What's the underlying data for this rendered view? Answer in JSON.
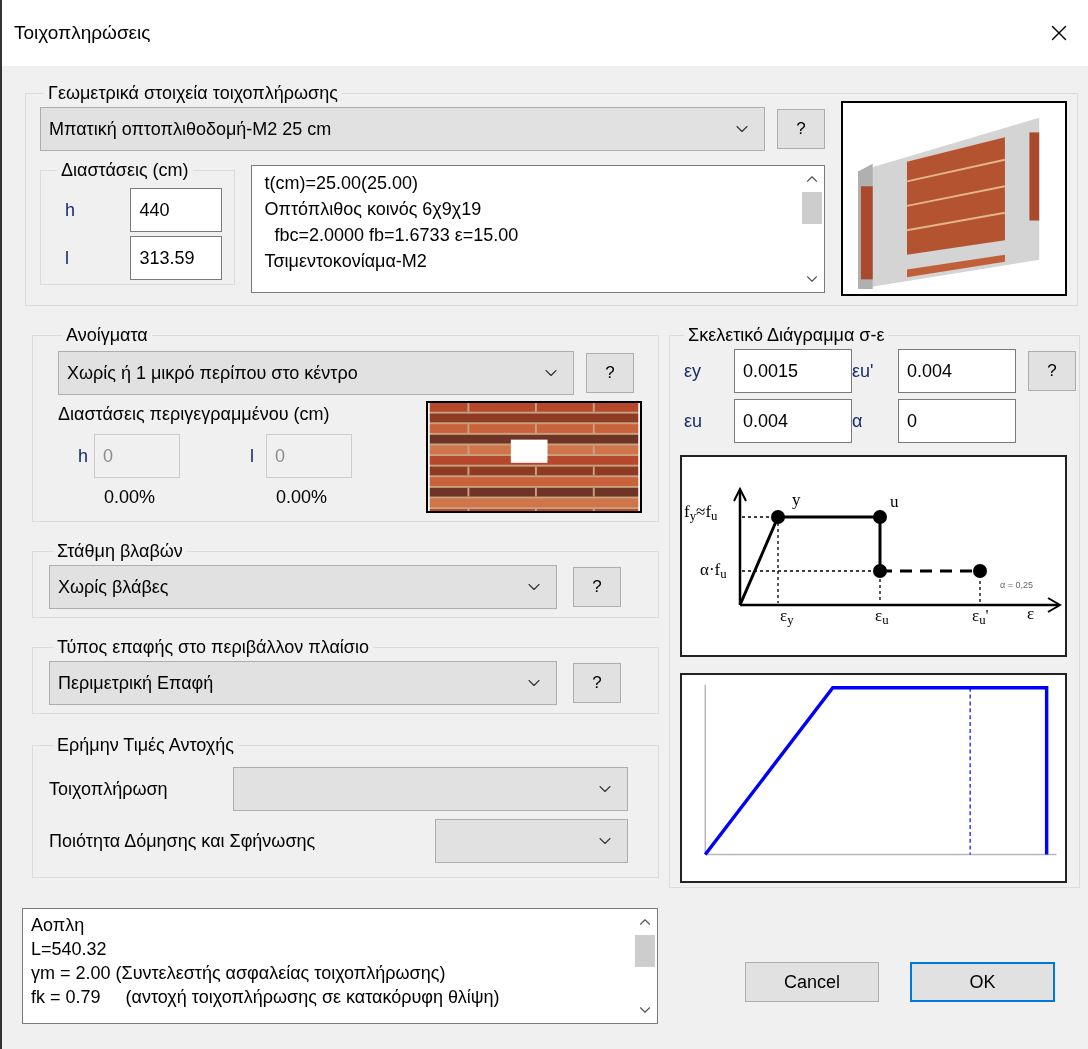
{
  "window": {
    "title": "Τοιχοπληρώσεις"
  },
  "geometry": {
    "legend": "Γεωμετρικά στοιχεία τοιχοπλήρωσης",
    "dropdown": "Μπατική οπτοπλιθοδομή-Μ2 25 cm",
    "help_button": "?",
    "dimensions": {
      "legend": "Διαστάσεις (cm)",
      "fields": [
        {
          "label": "h",
          "value": "440"
        },
        {
          "label": "l",
          "value": "313.59"
        }
      ]
    },
    "info_lines": [
      "t(cm)=25.00(25.00)",
      "Οπτόπλιθος κοινός 6χ9χ19",
      "  fbc=2.0000 fb=1.6733 ε=15.00",
      "Τσιμεντοκονίαμα-Μ2"
    ]
  },
  "openings": {
    "legend": "Ανοίγματα",
    "dropdown": "Χωρίς ή 1 μικρό περίπου στο κέντρο",
    "help_button": "?",
    "outline_label": "Διαστάσεις περιγεγραμμένου (cm)",
    "fields": [
      {
        "label": "h",
        "value": "0",
        "disabled": true,
        "percent": "0.00%"
      },
      {
        "label": "l",
        "value": "0",
        "disabled": true,
        "percent": "0.00%"
      }
    ]
  },
  "damage": {
    "legend": "Στάθμη βλαβών",
    "dropdown": "Χωρίς βλάβες",
    "help_button": "?"
  },
  "contact": {
    "legend": "Τύπος επαφής στο περιβάλλον πλαίσιο",
    "dropdown": "Περιμετρική Επαφή",
    "help_button": "?"
  },
  "resistance": {
    "legend": "Ερήμην Τιμές Αντοχής",
    "rows": [
      {
        "label": "Τοιχοπλήρωση"
      },
      {
        "label": "Ποιότητα Δόμησης και Σφήνωσης"
      }
    ]
  },
  "skeleton": {
    "legend": "Σκελετικό Διάγραμμα σ-ε",
    "help_button": "?",
    "fields": [
      {
        "label": "εy",
        "value": "0.0015"
      },
      {
        "label": "εu'",
        "value": "0.004"
      },
      {
        "label": "εu",
        "value": "0.004"
      },
      {
        "label": "α",
        "value": "0"
      }
    ],
    "diagram_labels": [
      "f$_{y}$≈f$_{u}$",
      "y",
      "u",
      "α·f$_{u}$",
      "ε$_{y}$",
      "ε$_{u}$",
      "ε$_{u}$'",
      "ε",
      "α = 0,25"
    ]
  },
  "notes": [
    "Αοπλη",
    "L=540.32",
    "γm = 2.00 (Συντελεστής ασφαλείας τοιχοπλήρωσης)",
    "fk = 0.79     (αντοχή τοιχοπλήρωσης σε κατακόρυφη θλίψη)"
  ],
  "buttons": [
    {
      "label": "Cancel",
      "default": false
    },
    {
      "label": "OK",
      "default": true
    }
  ]
}
